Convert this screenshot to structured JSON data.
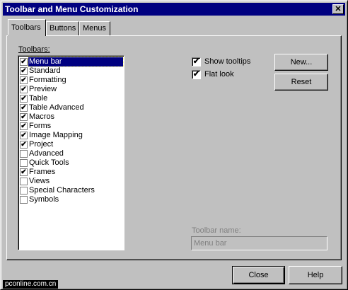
{
  "window": {
    "title": "Toolbar and Menu Customization",
    "close_glyph": "✕"
  },
  "tabs": [
    {
      "label": "Toolbars"
    },
    {
      "label": "Buttons"
    },
    {
      "label": "Menus"
    }
  ],
  "toolbars_label": "Toolbars:",
  "toolbar_items": [
    {
      "label": "Menu bar",
      "checked": true
    },
    {
      "label": "Standard",
      "checked": true
    },
    {
      "label": "Formatting",
      "checked": true
    },
    {
      "label": "Preview",
      "checked": true
    },
    {
      "label": "Table",
      "checked": true
    },
    {
      "label": "Table Advanced",
      "checked": true
    },
    {
      "label": "Macros",
      "checked": true
    },
    {
      "label": "Forms",
      "checked": true
    },
    {
      "label": "Image Mapping",
      "checked": true
    },
    {
      "label": "Project",
      "checked": true
    },
    {
      "label": "Advanced",
      "checked": false
    },
    {
      "label": "Quick Tools",
      "checked": false
    },
    {
      "label": "Frames",
      "checked": true
    },
    {
      "label": "Views",
      "checked": false
    },
    {
      "label": "Special Characters",
      "checked": false
    },
    {
      "label": "Symbols",
      "checked": false
    }
  ],
  "selected_index": 0,
  "options": {
    "show_tooltips": {
      "label": "Show tooltips",
      "checked": true
    },
    "flat_look": {
      "label": "Flat look",
      "checked": true
    }
  },
  "buttons": {
    "new": "New...",
    "reset": "Reset",
    "close": "Close",
    "help": "Help"
  },
  "toolbar_name": {
    "label": "Toolbar name:",
    "value": "Menu bar"
  },
  "watermark": "pconline.com.cn",
  "check_glyph": "✔"
}
